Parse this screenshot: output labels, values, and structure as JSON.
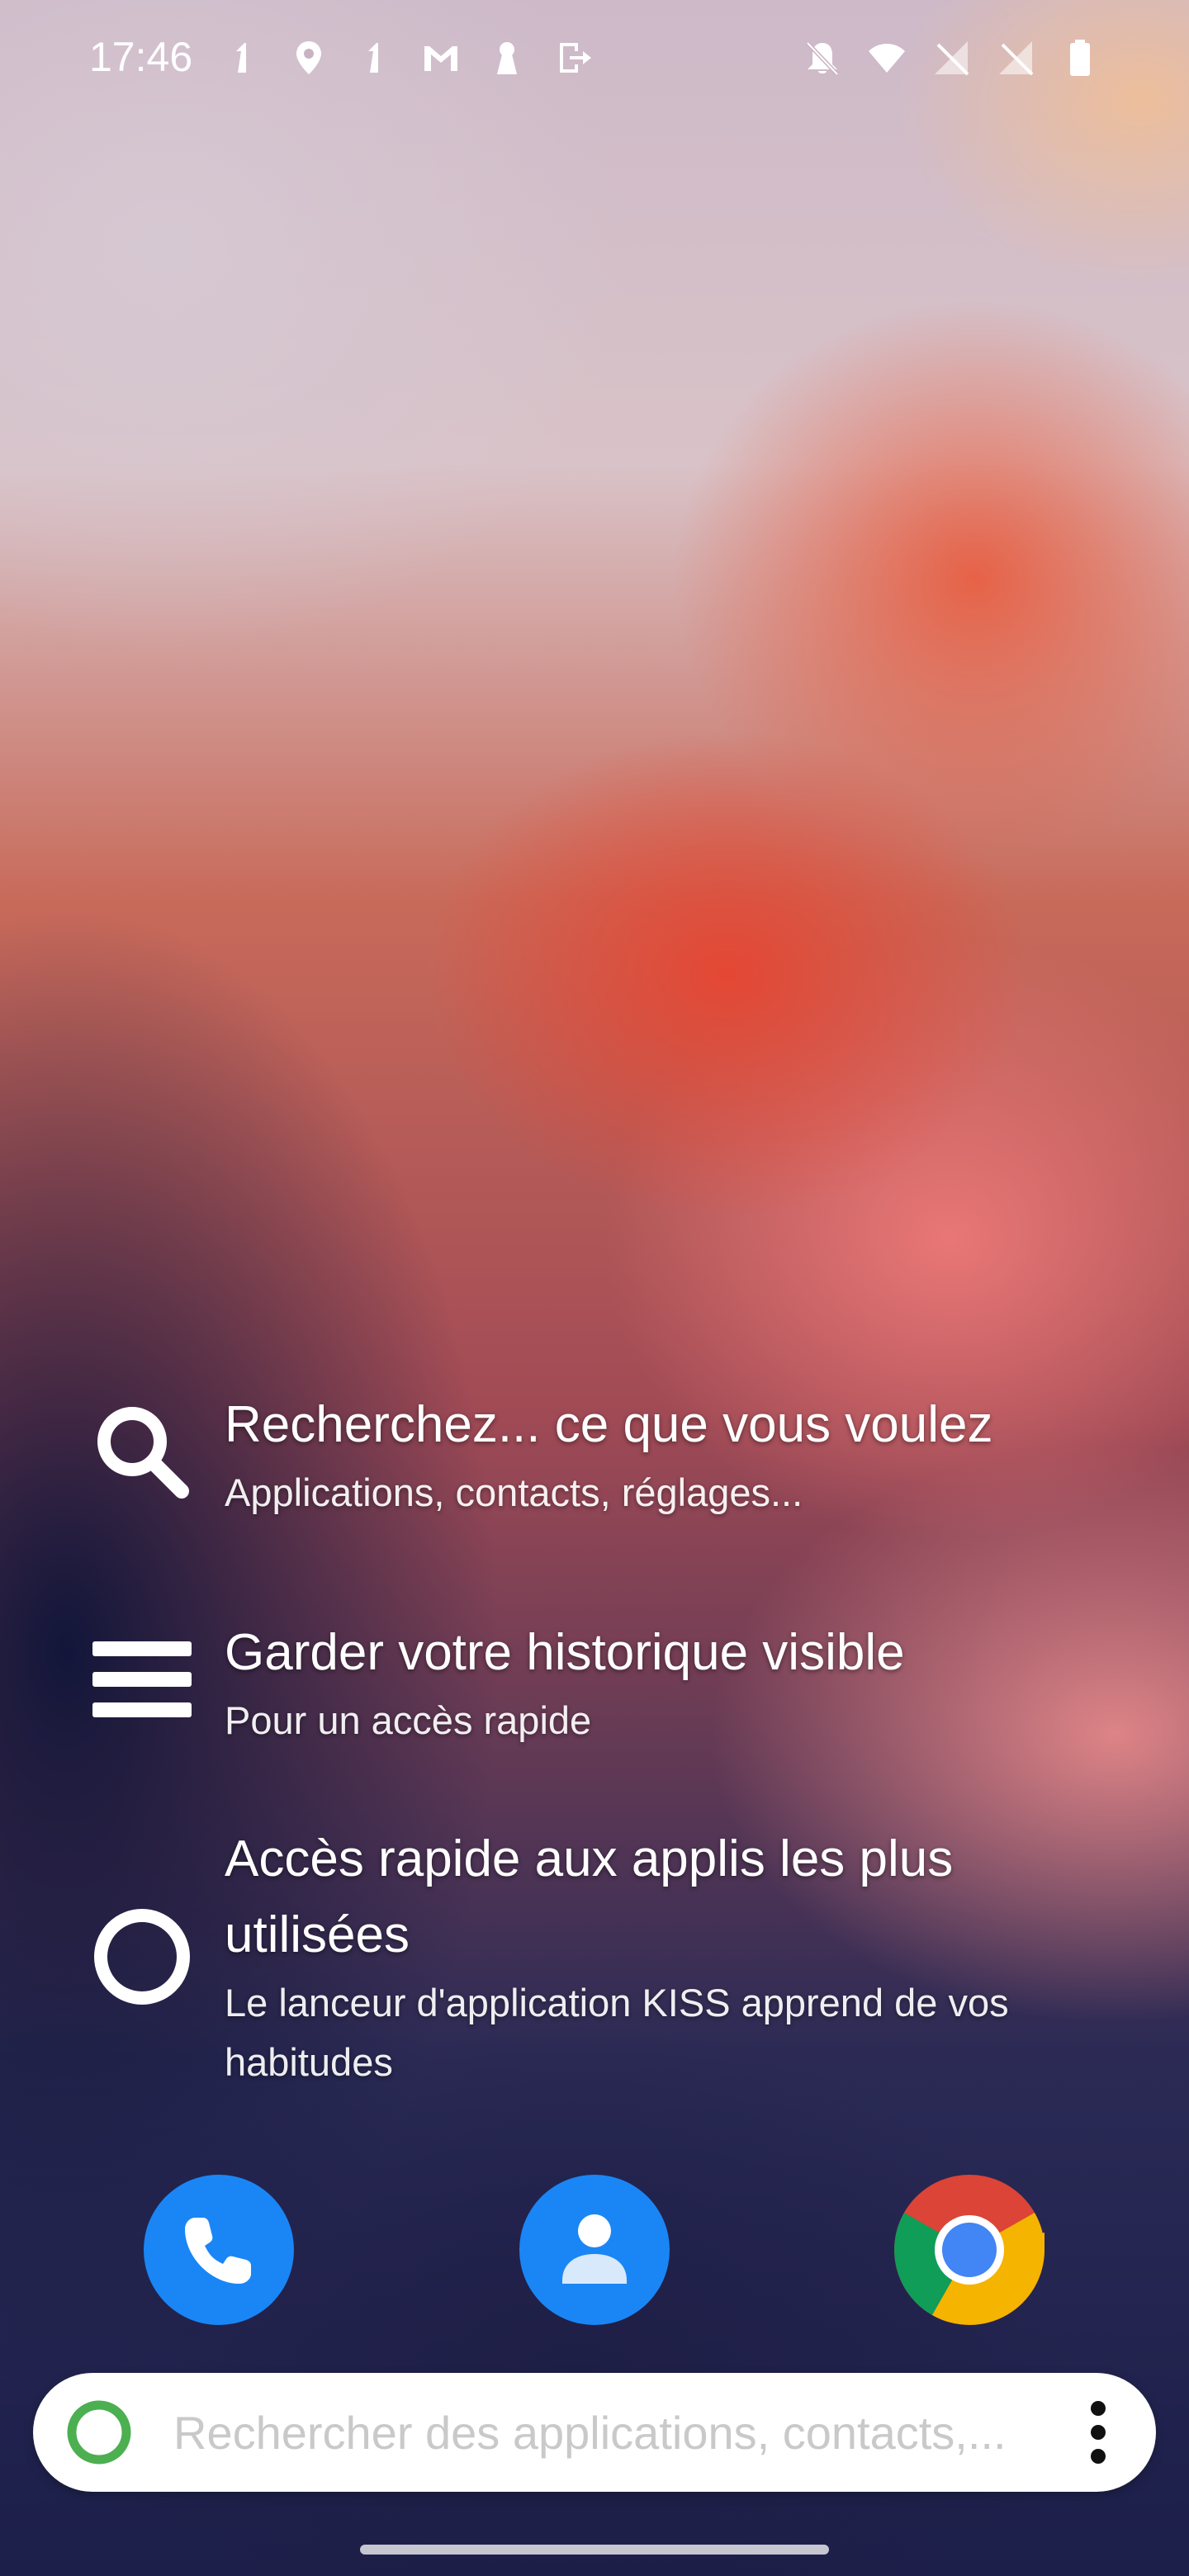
{
  "status_bar": {
    "time": "17:46",
    "left_icons": [
      "notification-1-icon",
      "location-pin-icon",
      "notification-1-icon",
      "gmail-icon",
      "keyhole-icon",
      "exit-icon"
    ],
    "right_icons": [
      "bell-off-icon",
      "wifi-icon",
      "no-sim-icon",
      "no-sim-icon",
      "battery-icon"
    ]
  },
  "tips": [
    {
      "icon": "search-icon",
      "title": "Recherchez... ce que vous voulez",
      "subtitle": "Applications, contacts, réglages..."
    },
    {
      "icon": "menu-icon",
      "title": "Garder votre historique visible",
      "subtitle": "Pour un accès rapide"
    },
    {
      "icon": "circle-icon",
      "title": "Accès rapide aux applis les plus utilisées",
      "subtitle": "Le lanceur d'application KISS apprend de vos habitudes"
    }
  ],
  "dock": {
    "apps": [
      {
        "name": "Phone",
        "icon": "phone-icon",
        "color": "#1a86f5"
      },
      {
        "name": "Contacts",
        "icon": "contacts-icon",
        "color": "#1a86f5"
      },
      {
        "name": "Chrome",
        "icon": "chrome-icon",
        "color": "#ffffff"
      }
    ]
  },
  "search": {
    "placeholder": "Rechercher des applications, contacts,...",
    "value": "",
    "ring_color": "#4caf50"
  }
}
